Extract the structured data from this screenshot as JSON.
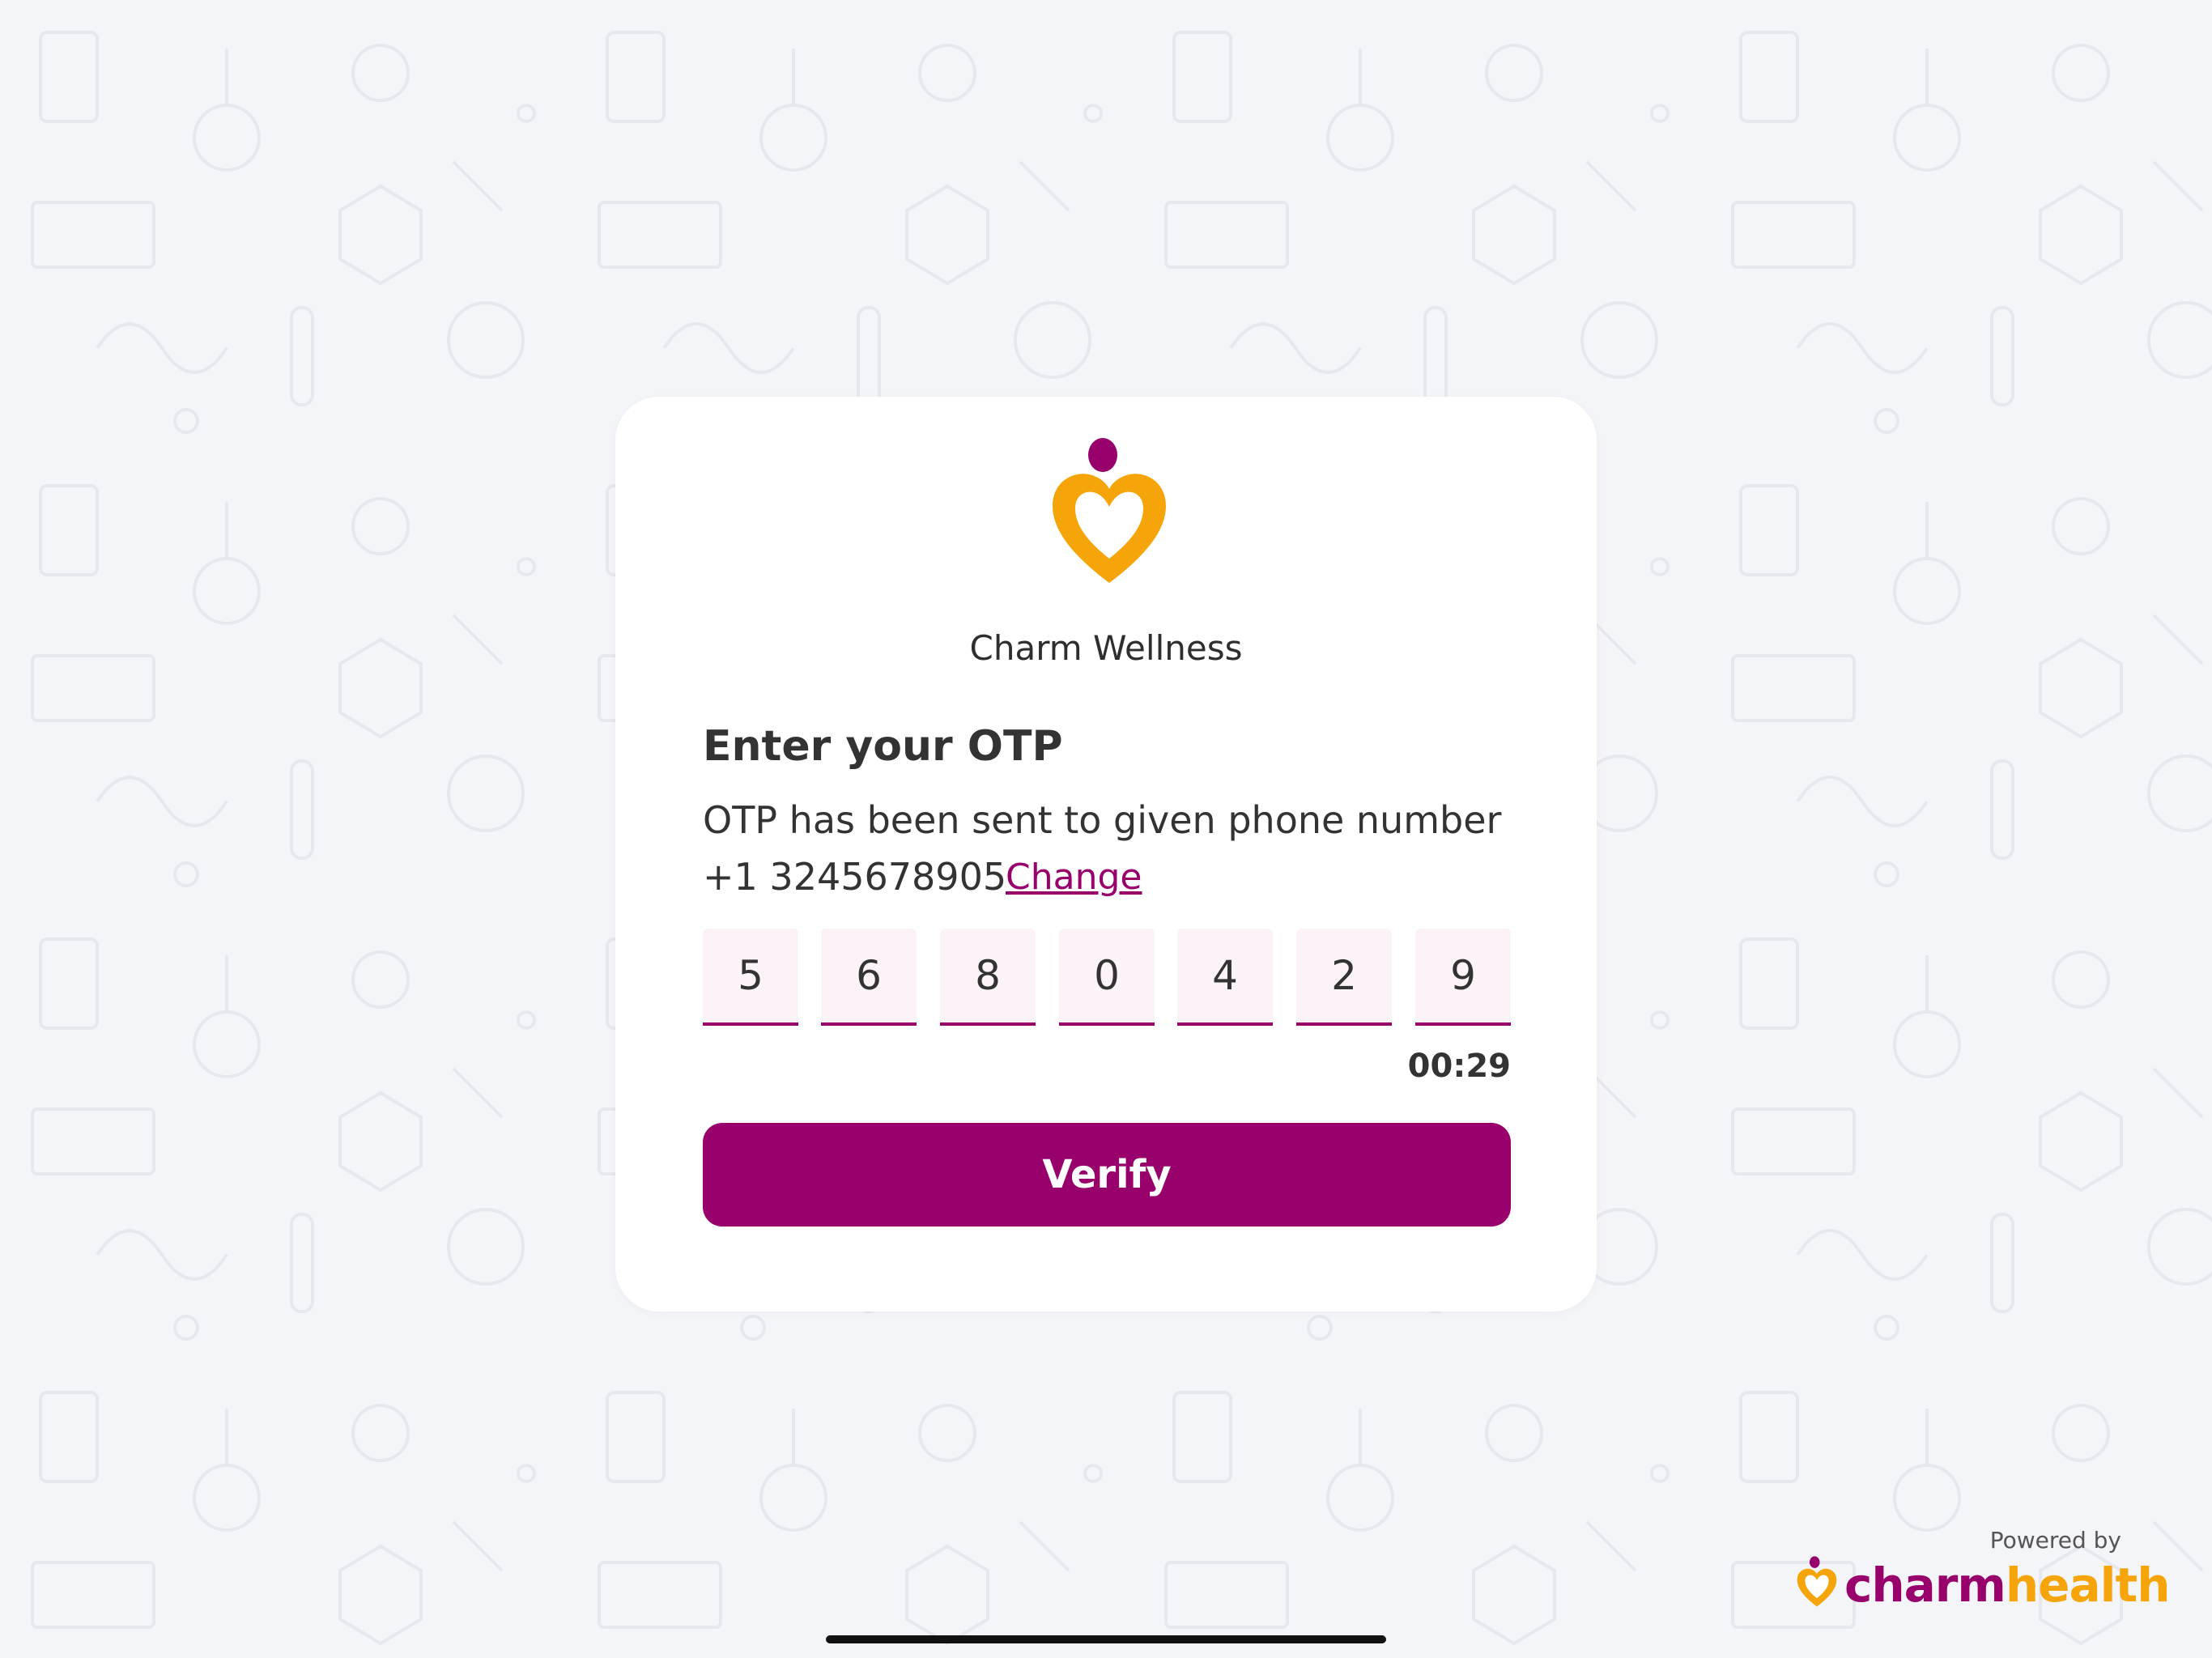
{
  "clinic": {
    "name": "Charm Wellness"
  },
  "otp": {
    "title": "Enter your OTP",
    "description": "OTP has been sent to given phone number",
    "phone": "+1 3245678905",
    "change_label": "Change",
    "digits": [
      "5",
      "6",
      "8",
      "0",
      "4",
      "2",
      "9"
    ],
    "timer": "00:29",
    "verify_label": "Verify"
  },
  "footer": {
    "powered_by": "Powered by",
    "brand_part1": "charm",
    "brand_part2": "health"
  },
  "colors": {
    "primary": "#98006b",
    "accent": "#f5a50a",
    "background": "#f4f5f8"
  }
}
